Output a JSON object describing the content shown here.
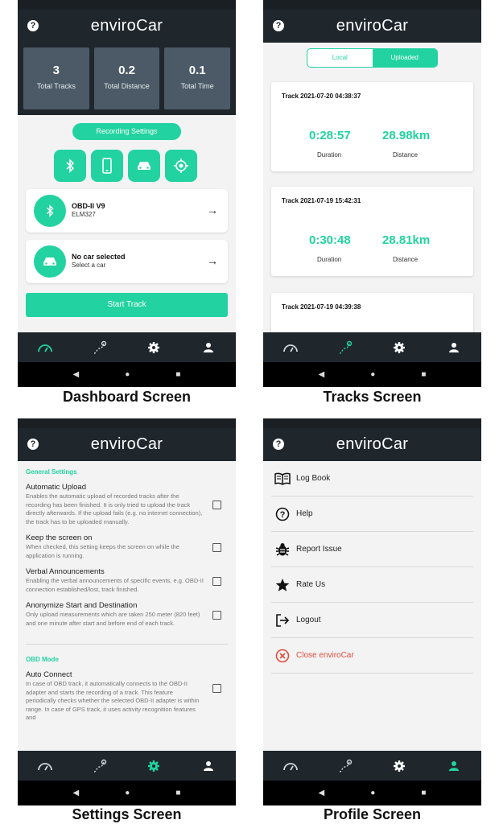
{
  "app": {
    "logo_text": "enviroCar",
    "help_glyph": "?",
    "accent": "#22d3a1",
    "dark": "#1f272d"
  },
  "captions": [
    "Dashboard Screen",
    "Tracks Screen",
    "Settings Screen",
    "Profile Screen"
  ],
  "dashboard": {
    "stats": [
      {
        "value": "3",
        "label": "Total Tracks"
      },
      {
        "value": "0.2",
        "label": "Total Distance"
      },
      {
        "value": "0.1",
        "label": "Total Time"
      }
    ],
    "recording_settings": "Recording Settings",
    "quick_icons": [
      "bluetooth-icon",
      "phone-icon",
      "car-icon",
      "gps-icon"
    ],
    "obd_card": {
      "title": "OBD-II V9",
      "subtitle": "ELM327",
      "arrow": "→"
    },
    "car_card": {
      "title": "No car selected",
      "subtitle": "Select a car",
      "arrow": "→"
    },
    "start_track": "Start Track"
  },
  "tracks": {
    "tabs": {
      "local": "Local",
      "uploaded": "Uploaded"
    },
    "items": [
      {
        "title": "Track 2021-07-20 04:38:37",
        "duration": "0:28:57",
        "distance": "28.98km"
      },
      {
        "title": "Track 2021-07-19 15:42:31",
        "duration": "0:30:48",
        "distance": "28.81km"
      },
      {
        "title": "Track 2021-07-19 04:39:38",
        "duration": "",
        "distance": ""
      }
    ],
    "duration_label": "Duration",
    "distance_label": "Distance"
  },
  "settings": {
    "general_header": "General Settings",
    "items": [
      {
        "title": "Automatic Upload",
        "desc": "Enables the automatic upload of recorded tracks after the recording has been finished. It is only tried to upload the track directly afterwards. If the upload fails (e.g. no internet connection), the track has to be uploaded manually."
      },
      {
        "title": "Keep the screen on",
        "desc": "When checked, this setting keeps the screen on while the application is running."
      },
      {
        "title": "Verbal Announcements",
        "desc": "Enabling the verbal announcements of specific events, e.g. OBD-II connection established/lost, track finished."
      },
      {
        "title": "Anonymize Start and Destination",
        "desc": "Only upload measurements which are taken 250 meter (820 feet) and one minute after start and before end of each track."
      }
    ],
    "obd_header": "OBD Mode",
    "obd_item": {
      "title": "Auto Connect",
      "desc": "In case of OBD track, it automatically connects to the OBD-II adapter and starts the recording of a track. This feature periodically checks whether the selected OBD-II adapter is within range. In case of GPS track, it uses activity recognition features and"
    }
  },
  "profile": {
    "items": [
      {
        "label": "Log Book",
        "icon": "book-icon"
      },
      {
        "label": "Help",
        "icon": "help-icon"
      },
      {
        "label": "Report Issue",
        "icon": "bug-icon"
      },
      {
        "label": "Rate Us",
        "icon": "star-icon"
      },
      {
        "label": "Logout",
        "icon": "logout-icon"
      },
      {
        "label": "Close enviroCar",
        "icon": "close-circle-icon"
      }
    ]
  },
  "bottom_nav": [
    "dashboard-icon",
    "tracks-icon",
    "settings-icon",
    "profile-icon"
  ],
  "system_nav": {
    "back": "◀",
    "home": "●",
    "recents": "■"
  }
}
